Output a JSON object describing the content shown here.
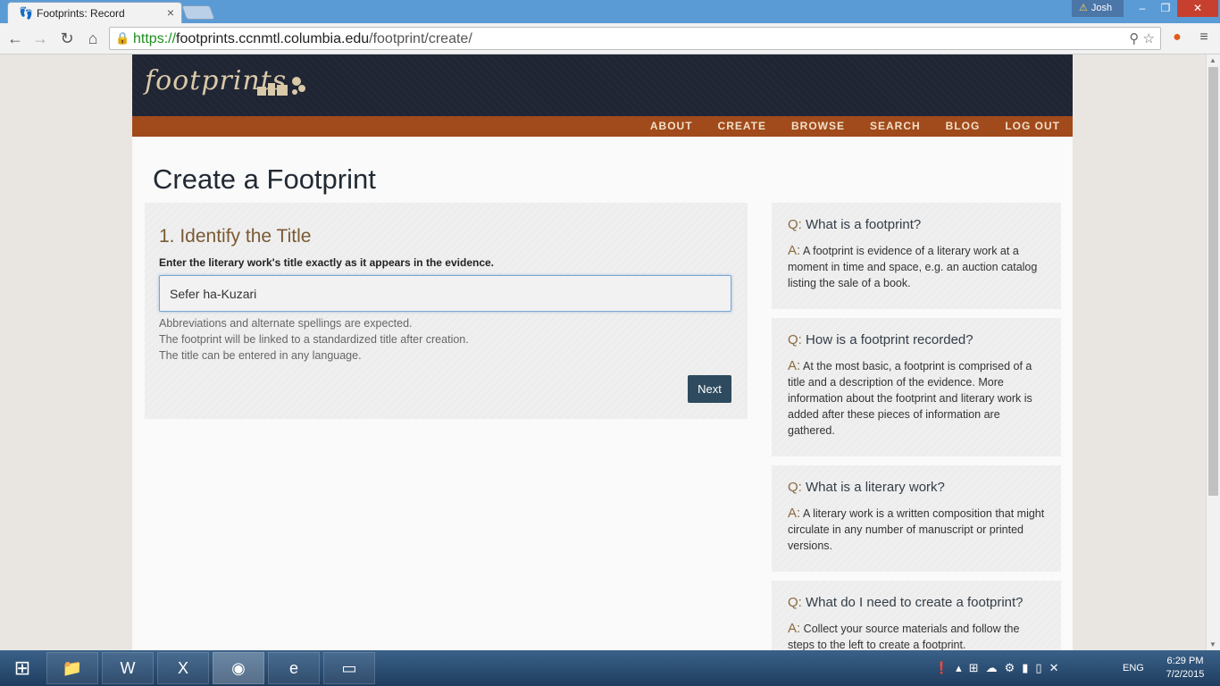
{
  "browser": {
    "tab_title": "Footprints: Record",
    "user": "Josh",
    "url_scheme": "https://",
    "url_host": "footprints.ccnmtl.columbia.edu",
    "url_path": "/footprint/create/"
  },
  "site": {
    "logo": "footprints",
    "nav": [
      "ABOUT",
      "CREATE",
      "BROWSE",
      "SEARCH",
      "BLOG",
      "LOG OUT"
    ],
    "page_title": "Create a Footprint"
  },
  "form": {
    "step_title": "1. Identify the Title",
    "label": "Enter the literary work's title exactly as it appears in the evidence.",
    "title_value": "Sefer ha-Kuzari",
    "help": [
      "Abbreviations and alternate spellings are expected.",
      "The footprint will be linked to a standardized title after creation.",
      "The title can be entered in any language."
    ],
    "next_label": "Next"
  },
  "faq": [
    {
      "q_prefix": "Q:",
      "q": "What is a footprint?",
      "a_prefix": "A:",
      "a": "A footprint is evidence of a literary work at a moment in time and space, e.g. an auction catalog listing the sale of a book."
    },
    {
      "q_prefix": "Q:",
      "q": "How is a footprint recorded?",
      "a_prefix": "A:",
      "a": "At the most basic, a footprint is comprised of a title and a description of the evidence. More information about the footprint and literary work is added after these pieces of information are gathered."
    },
    {
      "q_prefix": "Q:",
      "q": "What is a literary work?",
      "a_prefix": "A:",
      "a": "A literary work is a written composition that might circulate in any number of manuscript or printed versions."
    },
    {
      "q_prefix": "Q:",
      "q": "What do I need to create a footprint?",
      "a_prefix": "A:",
      "a": "Collect your source materials and follow the steps to the left to create a footprint."
    }
  ],
  "taskbar": {
    "lang": "ENG",
    "time": "6:29 PM",
    "date": "7/2/2015"
  }
}
